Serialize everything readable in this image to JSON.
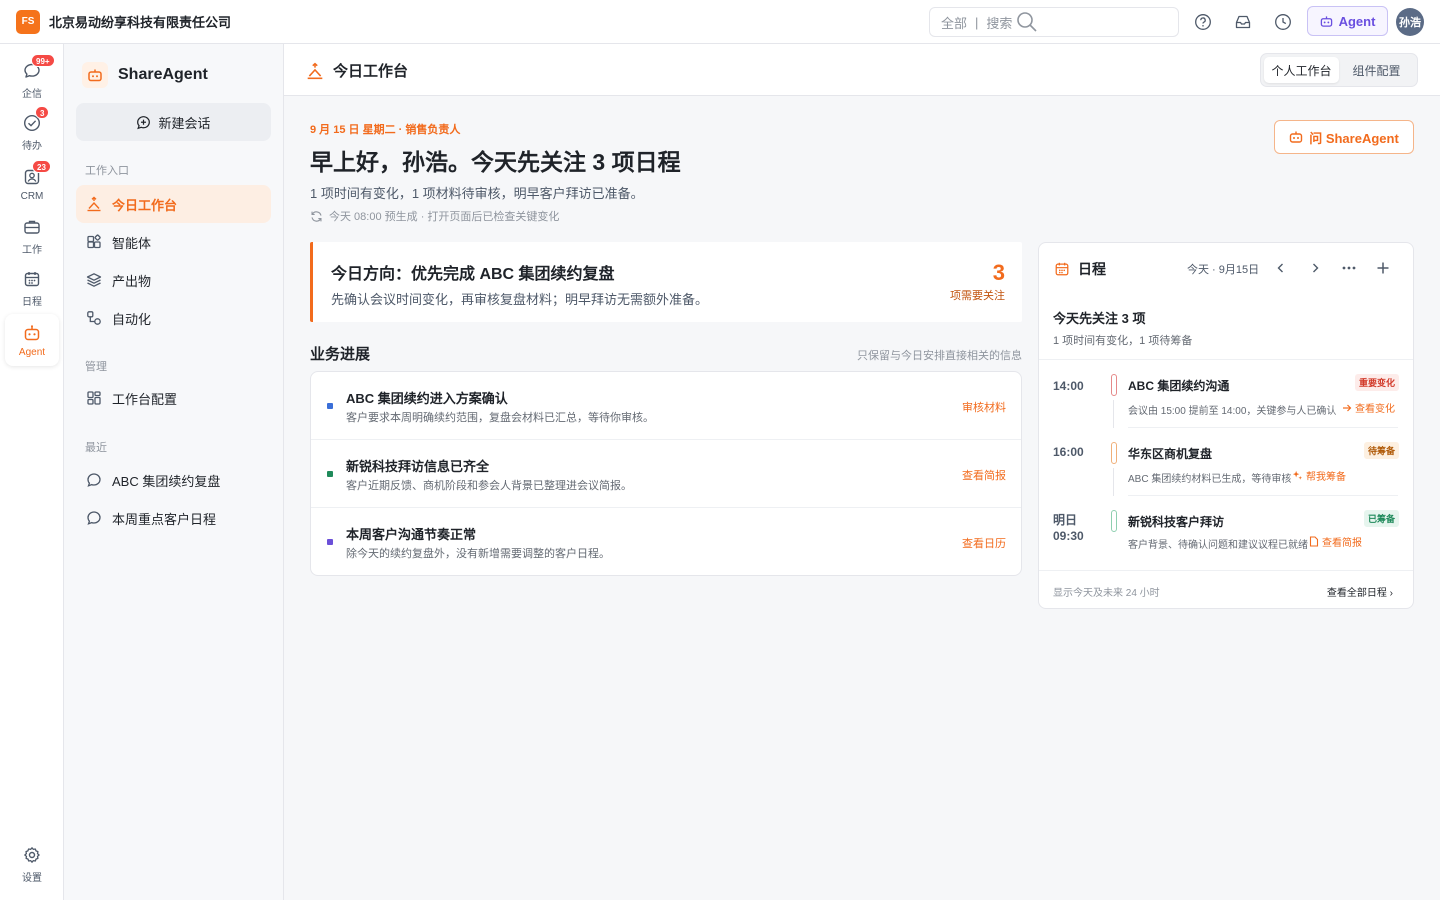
{
  "topbar": {
    "logo_text": "FS",
    "company": "北京易动纷享科技有限责任公司",
    "search_scope": "全部",
    "search_placeholder": "搜索",
    "agent_label": "Agent",
    "avatar": "孙浩",
    "icons": [
      "help-icon",
      "inbox-icon",
      "history-icon"
    ]
  },
  "rail": {
    "items": [
      {
        "label": "企信",
        "icon": "chat-icon",
        "badge": "99+"
      },
      {
        "label": "待办",
        "icon": "check-icon",
        "badge": "3"
      },
      {
        "label": "CRM",
        "icon": "crm-icon",
        "badge": "23"
      },
      {
        "label": "工作",
        "icon": "briefcase-icon",
        "badge": ""
      },
      {
        "label": "日程",
        "icon": "calendar-icon",
        "badge": ""
      },
      {
        "label": "Agent",
        "icon": "robot-icon",
        "badge": ""
      }
    ],
    "settings_label": "设置"
  },
  "sidebar": {
    "title": "ShareAgent",
    "new_chat": "新建会话",
    "section_entry": "工作入口",
    "entry_items": [
      "今日工作台",
      "智能体",
      "产出物",
      "自动化"
    ],
    "section_manage": "管理",
    "manage_items": [
      "工作台配置"
    ],
    "section_recent": "最近",
    "recent_items": [
      "ABC 集团续约复盘",
      "本周重点客户日程"
    ]
  },
  "header": {
    "title": "今日工作台",
    "tab_personal": "个人工作台",
    "tab_widgets": "组件配置"
  },
  "greeting": {
    "date_line": "9 月 15 日 星期二 · 销售负责人",
    "headline": "早上好，孙浩。今天先关注 3 项日程",
    "summary": "1 项时间有变化，1 项材料待审核，明早客户拜访已准备。",
    "generated": "今天 08:00 预生成 · 打开页面后已检查关键变化",
    "ask_label": "问 ShareAgent"
  },
  "focus": {
    "title": "今日方向：优先完成 ABC 集团续约复盘",
    "desc": "先确认会议时间变化，再审核复盘材料；明早拜访无需额外准备。",
    "count": "3",
    "count_label": "项需要关注"
  },
  "progress": {
    "title": "业务进展",
    "note": "只保留与今日安排直接相关的信息",
    "items": [
      {
        "title": "ABC 集团续约进入方案确认",
        "desc": "客户要求本周明确续约范围，复盘会材料已汇总，等待你审核。",
        "action": "审核材料",
        "color": "#3b6fd8"
      },
      {
        "title": "新锐科技拜访信息已齐全",
        "desc": "客户近期反馈、商机阶段和参会人背景已整理进会议简报。",
        "action": "查看简报",
        "color": "#1f8a5b"
      },
      {
        "title": "本周客户沟通节奏正常",
        "desc": "除今天的续约复盘外，没有新增需要调整的客户日程。",
        "action": "查看日历",
        "color": "#6b4fd8"
      }
    ]
  },
  "schedule": {
    "title": "日程",
    "date": "今天 · 9月15日",
    "summary_title": "今天先关注 3 项",
    "summary_desc": "1 项时间有变化，1 项待筹备",
    "events": [
      {
        "time": "14:00",
        "title": "ABC 集团续约沟通",
        "desc": "会议由 15:00 提前至 14:00，关键参与人已确认",
        "link": "查看变化",
        "tag": "重要变化",
        "tag_color": "#d23b2b",
        "tag_bg": "#fdecea",
        "line_color": "#e58a8a"
      },
      {
        "time": "16:00",
        "title": "华东区商机复盘",
        "desc": "ABC 集团续约材料已生成，等待审核",
        "link": "帮我筹备",
        "tag": "待筹备",
        "tag_color": "#b05a08",
        "tag_bg": "#fdf0e1",
        "line_color": "#f0b07a"
      },
      {
        "time": "明日\n09:30",
        "title": "新锐科技客户拜访",
        "desc": "客户背景、待确认问题和建议议程已就绪",
        "link": "查看简报",
        "tag": "已筹备",
        "tag_color": "#1f8a5b",
        "tag_bg": "#e6f5ee",
        "line_color": "#8fcfb0"
      }
    ],
    "footer": "显示今天及未来 24 小时",
    "view_all": "查看全部日程 ›"
  },
  "colors": {
    "accent": "#f26b1d",
    "agent": "#6a4fe0",
    "badge": "#f54a45"
  }
}
